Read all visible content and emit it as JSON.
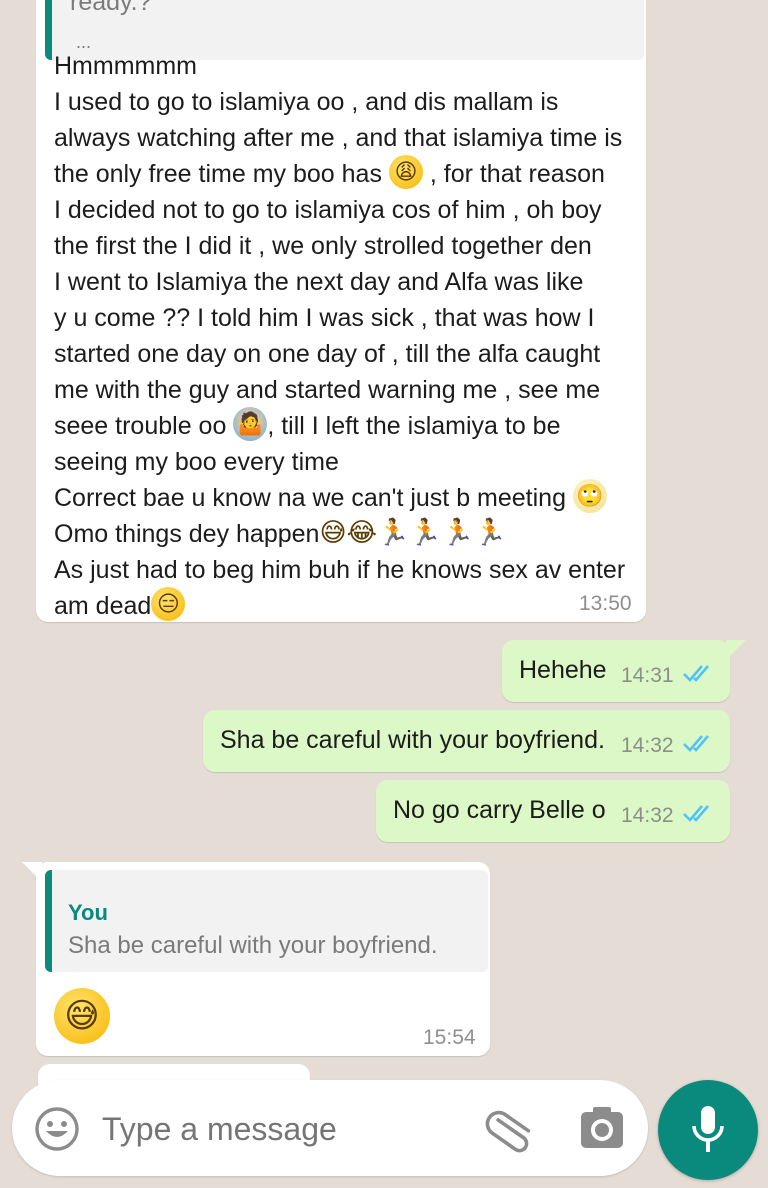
{
  "top_message": {
    "quote_text": "ready.?",
    "quote_more": "...",
    "lines": [
      {
        "text": "Hmmmmmm"
      },
      {
        "text": "I used to go to islamiya oo , and dis mallam is"
      },
      {
        "text": "always watching after me , and that islamiya time is"
      },
      {
        "text": "the only free time my boo has",
        "emoji": "weary-face-emoji",
        "glyph": "😩",
        "after": " , for that reason"
      },
      {
        "text": "I decided not to go to islamiya cos of him , oh boy"
      },
      {
        "text": "the first the I did it , we only strolled together den"
      },
      {
        "text": "I went to Islamiya the next day and Alfa was like"
      },
      {
        "text": "y u come ?? I told him I was sick , that was how I"
      },
      {
        "text": "started one day on one day of , till the alfa caught"
      },
      {
        "text": "me with the guy and started warning me , see me"
      },
      {
        "text": "seee trouble oo",
        "emoji": "woman-shrugging-emoji",
        "glyph": "🤷",
        "after": ", till I left the islamiya to be"
      },
      {
        "text": "seeing my boo every time"
      },
      {
        "text": "Correct bae u know na we can't just b meeting",
        "emoji": "face-with-rolling-eyes-emoji",
        "glyph": "🙄"
      },
      {
        "text": "Omo things dey happen",
        "emoji": "grinning-sweat-and-joy-emojis",
        "glyph": "😅😂🏃🏃🏃🏃"
      },
      {
        "text": "As just had to beg him buh if he knows sex av enter"
      },
      {
        "text": "am dead",
        "emoji": "expressionless-face-emoji",
        "glyph": "😑"
      }
    ],
    "time": "13:50"
  },
  "outgoing": [
    {
      "text": "Hehehe",
      "time": "14:31",
      "status": "read"
    },
    {
      "text": "Sha be careful with your boyfriend.",
      "time": "14:32",
      "status": "read"
    },
    {
      "text": "No go carry Belle o",
      "time": "14:32",
      "status": "read"
    }
  ],
  "reply_message": {
    "quote_author": "You",
    "quote_text": "Sha be careful with your boyfriend.",
    "emoji": "grinning-face-with-sweat-emoji",
    "glyph": "😅",
    "time": "15:54"
  },
  "input": {
    "placeholder": "Type a message",
    "emoji_icon": "smiley-icon",
    "attach_icon": "paperclip-icon",
    "camera_icon": "camera-icon",
    "mic_icon": "microphone-icon"
  },
  "colors": {
    "background": "#e5ddd5",
    "outgoing_bubble": "#dcf8c6",
    "incoming_bubble": "#ffffff",
    "accent": "#0a8a7c",
    "read_ticks": "#4fc3f7"
  }
}
